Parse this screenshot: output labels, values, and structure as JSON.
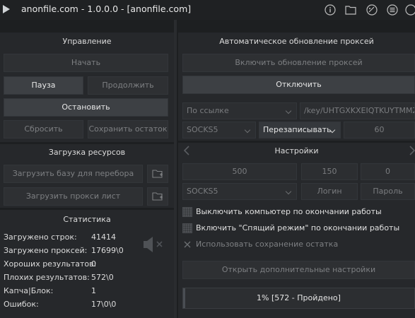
{
  "window": {
    "title": "anonfile.com - 1.0.0.0 - [anonfile.com]"
  },
  "left": {
    "control": {
      "header": "Управление",
      "start": "Начать",
      "pause": "Пауза",
      "continue": "Продолжить",
      "stop": "Остановить",
      "reset": "Сбросить",
      "save_rest": "Сохранить остаток"
    },
    "resources": {
      "header": "Загрузка ресурсов",
      "load_base": "Загрузить базу для перебора",
      "load_proxy": "Загрузить прокси лист"
    },
    "stats": {
      "header": "Статистика",
      "rows": [
        {
          "label": "Загружено строк:",
          "value": "41414"
        },
        {
          "label": "Загружено проксей:",
          "value": "17699\\0"
        },
        {
          "label": "Хороших результатов:",
          "value": "0"
        },
        {
          "label": "Плохих результатов:",
          "value": "572\\0"
        },
        {
          "label": "Капча|Блок:",
          "value": "1"
        },
        {
          "label": "Ошибок:",
          "value": "17\\0\\0"
        }
      ]
    }
  },
  "right": {
    "proxy": {
      "header": "Автоматическое обновление проксей",
      "enable": "Включить обновление проксей",
      "disable": "Отключить",
      "source_select": "По ссылке",
      "url": "/key/UHTGXKXEIQTKUYTMMZIYCC",
      "type_select": "SOCKS5",
      "mode_select": "Перезаписывать",
      "interval": "60"
    },
    "settings": {
      "header": "Настройки",
      "threads": "500",
      "timeout": "150",
      "retries": "0",
      "proxy_type": "SOCKS5",
      "login_placeholder": "Логин",
      "password_placeholder": "Пароль",
      "options": [
        {
          "label": "Выключить компьютер по окончании работы",
          "enabled": true
        },
        {
          "label": "Включить \"Спящий режим\" по окончании работы",
          "enabled": true
        },
        {
          "label": "Использовать сохранение остатка",
          "enabled": false
        }
      ],
      "more": "Открыть дополнительные настройки"
    },
    "progress": {
      "label": "1% [572 - Пройдено]",
      "fraction": 0.01
    }
  },
  "colors": {
    "background": "#1d1f21",
    "panel": "#26282b",
    "button_active": "#3d4044"
  }
}
